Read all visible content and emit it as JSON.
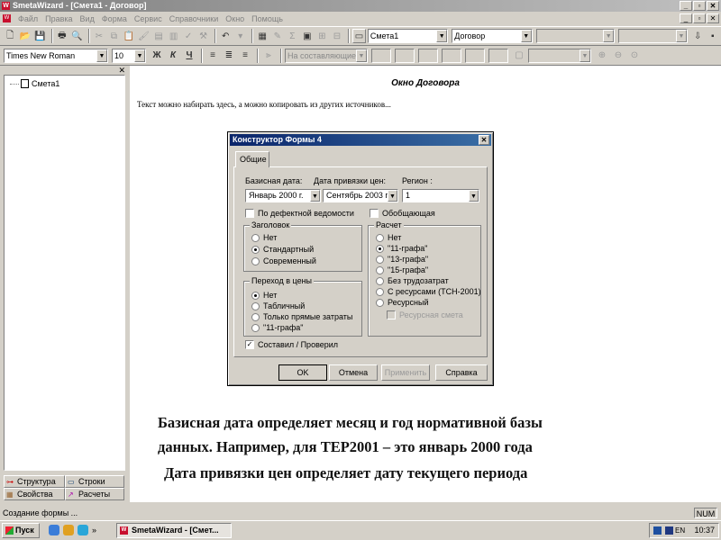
{
  "app": {
    "title": "SmetaWizard - [Смета1 - Договор]",
    "window_buttons": [
      "_",
      "▫",
      "✕"
    ],
    "mdi_buttons": [
      "_",
      "▫",
      "✕"
    ]
  },
  "menu": [
    "Файл",
    "Правка",
    "Вид",
    "Форма",
    "Сервис",
    "Справочники",
    "Окно",
    "Помощь"
  ],
  "toolbar1": {
    "estimate_combo": "Смета1",
    "form_combo": "Договор"
  },
  "toolbar2": {
    "font_combo": "Times New Roman",
    "size_combo": "10",
    "bold": "Ж",
    "italic": "К",
    "underline": "Ч",
    "level_combo": "На составляющие"
  },
  "left_pane": {
    "close": "✕",
    "tree_item": "Смета1",
    "tabs": [
      "Структура",
      "Строки",
      "Свойства",
      "Расчеты"
    ]
  },
  "document": {
    "title": "Окно Договора",
    "hint": "Текст можно набирать здесь, а можно копировать из других источников...",
    "captions": [
      "Базисная дата определяет месяц и год нормативной базы",
      "данных.  Например, для ТЕР2001 – это январь 2000 года",
      "Дата привязки цен определяет дату текущего периода"
    ]
  },
  "dialog": {
    "title": "Конструктор Формы 4",
    "close": "✕",
    "tab": "Общие",
    "base_date_label": "Базисная дата:",
    "base_date_value": "Январь  2000 г.",
    "price_date_label": "Дата привязки цен:",
    "price_date_value": "Сентябрь 2003 г.",
    "region_label": "Регион :",
    "region_value": "1",
    "defect_checkbox": "По дефектной ведомости",
    "summary_checkbox": "Обобщающая",
    "header_group": {
      "title": "Заголовок",
      "options": [
        "Нет",
        "Стандартный",
        "Современный"
      ],
      "selected": 1
    },
    "price_group": {
      "title": "Переход в цены",
      "options": [
        "Нет",
        "Табличный",
        "Только прямые затраты",
        "\"11-графа\""
      ],
      "selected": 0
    },
    "calc_group": {
      "title": "Расчет",
      "options": [
        "Нет",
        "\"11-графа\"",
        "\"13-графа\"",
        "\"15-графа\"",
        "Без трудозатрат",
        "С ресурсами (ТСН-2001)",
        "Ресурсный"
      ],
      "selected": 1,
      "resource_estimate": "Ресурсная смета"
    },
    "signed_checkbox": "Составил / Проверил",
    "signed_checked": true,
    "buttons": {
      "ok": "OK",
      "cancel": "Отмена",
      "apply": "Применить",
      "help": "Справка"
    }
  },
  "status": {
    "text": "Создание формы ...",
    "num": "NUM"
  },
  "taskbar": {
    "start": "Пуск",
    "chevron": "»",
    "task": "SmetaWizard - [Смет...",
    "lang": "EN",
    "clock": "10:37"
  },
  "colors": {
    "title_active": "#0a246a",
    "title_inactive": "#808080",
    "face": "#d4d0c8"
  }
}
